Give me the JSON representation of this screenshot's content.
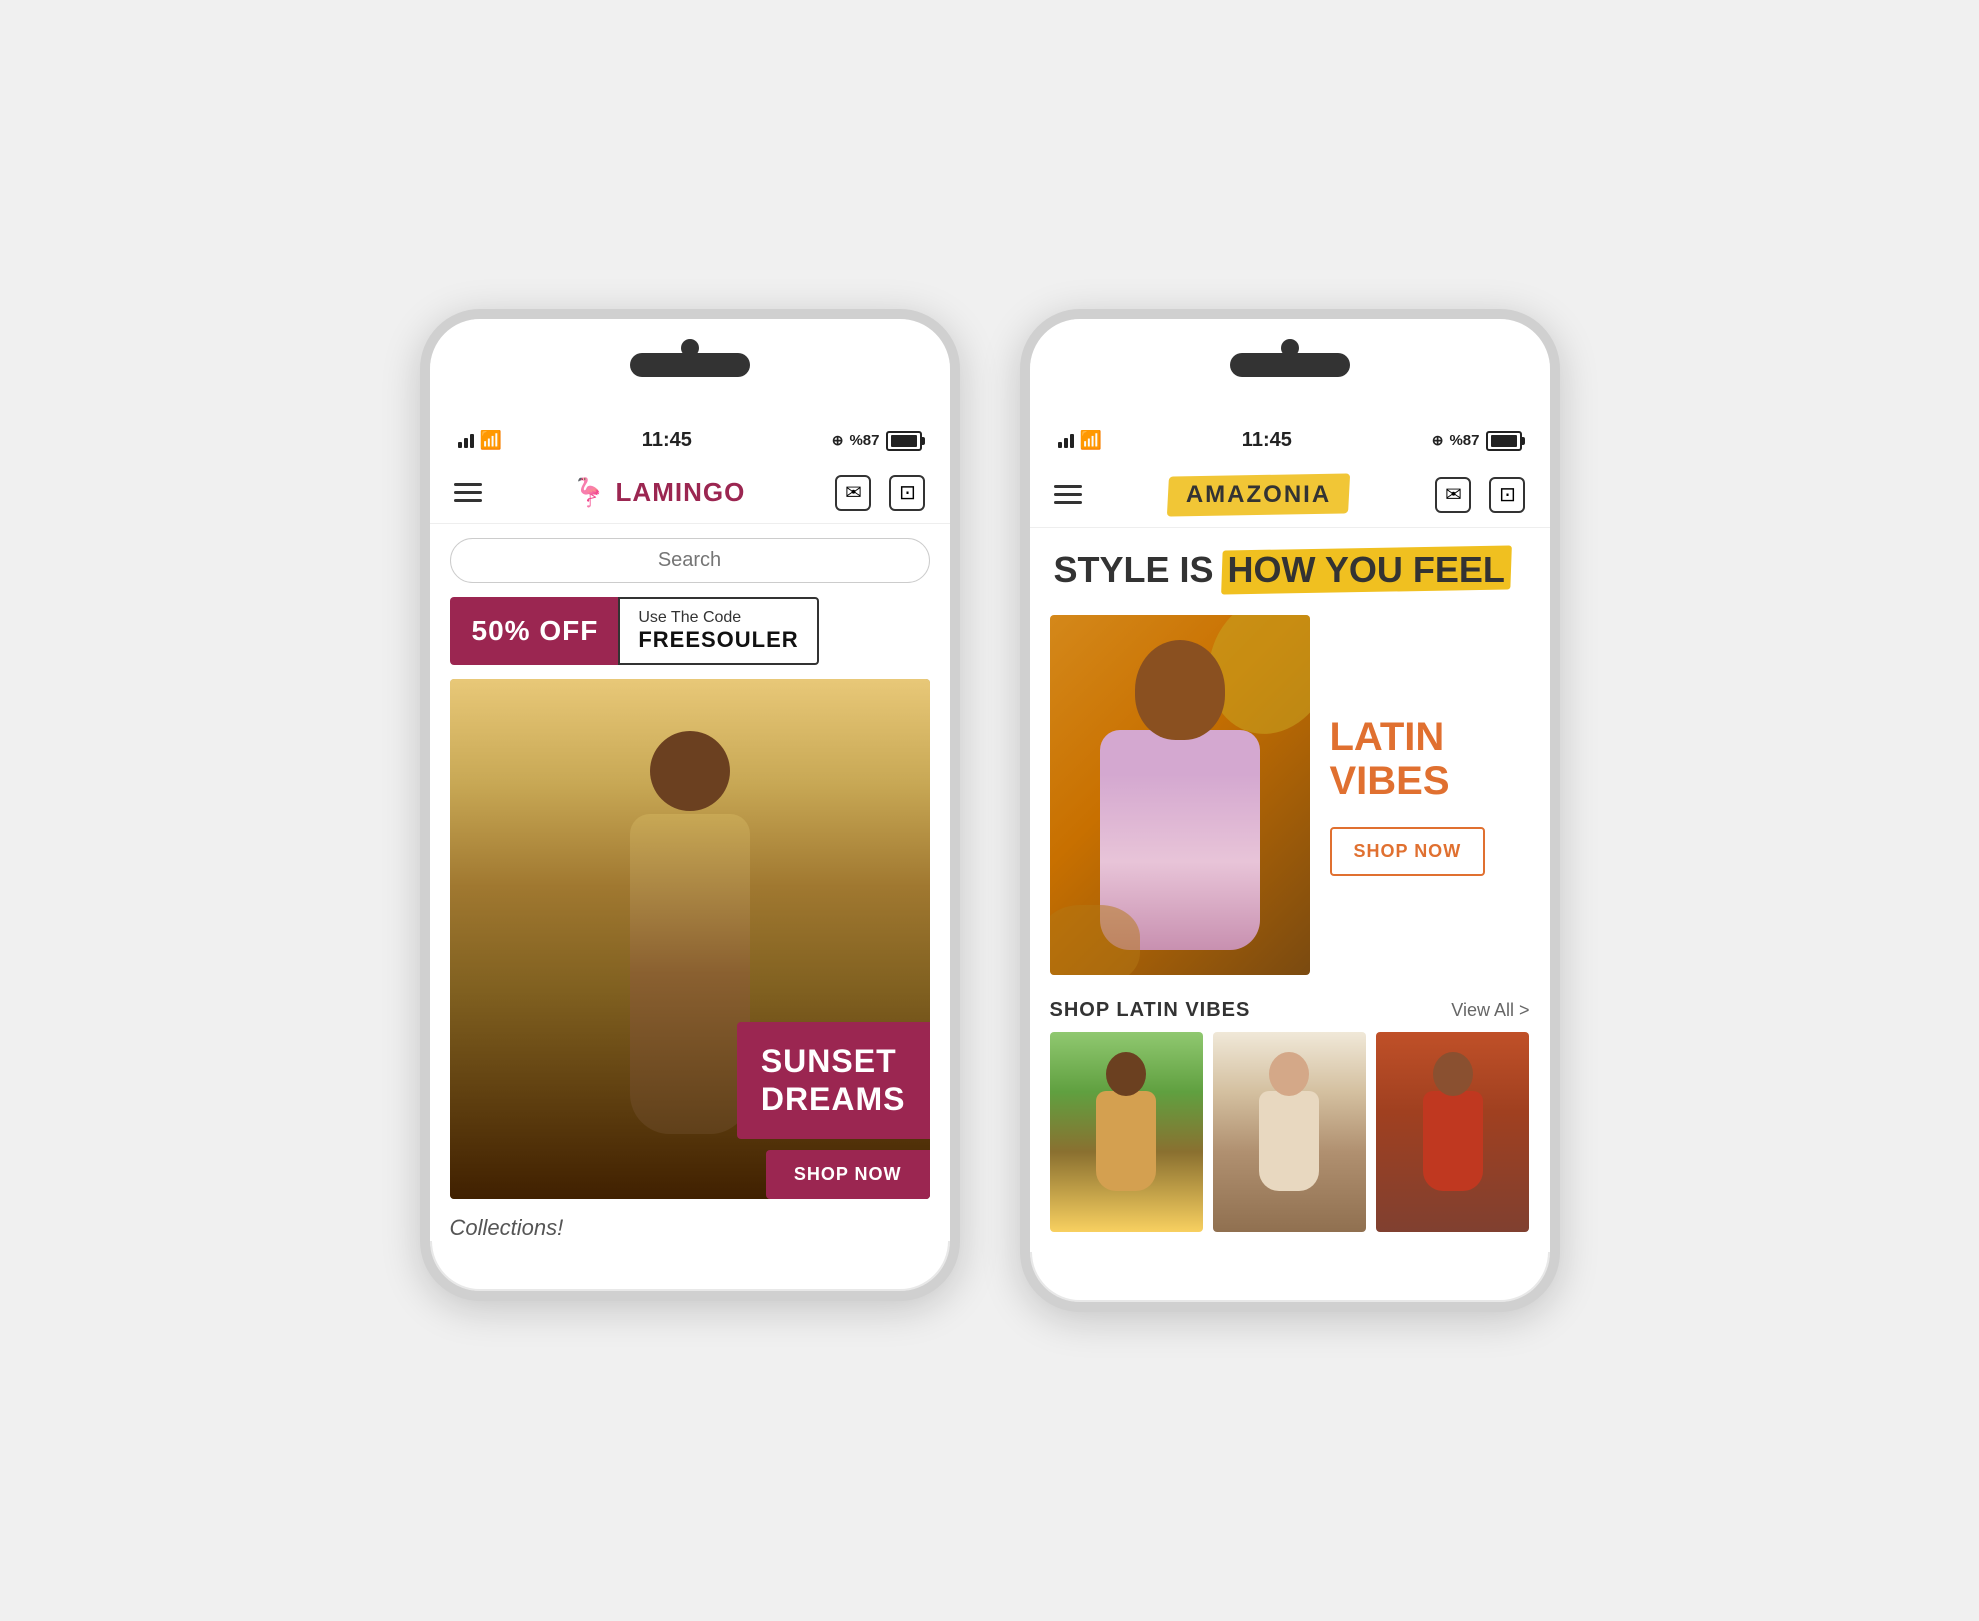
{
  "phones": [
    {
      "id": "lamingo",
      "statusBar": {
        "time": "11:45",
        "battery": "%87",
        "signal": 3
      },
      "header": {
        "logo": "LAMINGO",
        "flamingo": "🦩"
      },
      "search": {
        "placeholder": "Search"
      },
      "promo": {
        "discount": "50% OFF",
        "codeLabel": "Use The Code",
        "code": "FREESOULER"
      },
      "hero": {
        "title1": "SUNSET",
        "title2": "DREAMS",
        "shopBtn": "SHOP NOW"
      },
      "collections": {
        "label": "Collections!"
      }
    },
    {
      "id": "amazonia",
      "statusBar": {
        "time": "11:45",
        "battery": "%87",
        "signal": 3
      },
      "header": {
        "logo": "AMAZONIA"
      },
      "heroBanner": {
        "line1plain": "STYLE IS",
        "line1highlight": "HOW YOU FEEL",
        "highlightColor": "#f0c020"
      },
      "latinVibes": {
        "title1": "LATIN",
        "title2": "VIBES",
        "shopBtn": "SHOP NOW",
        "color": "#e07030"
      },
      "shopSection": {
        "title": "SHOP LATIN VIBES",
        "viewAll": "View All >"
      },
      "icons": {
        "message": "💬",
        "cart": "🛍"
      }
    }
  ],
  "messageIconChar": "✉",
  "cartIconChar": "⊡"
}
